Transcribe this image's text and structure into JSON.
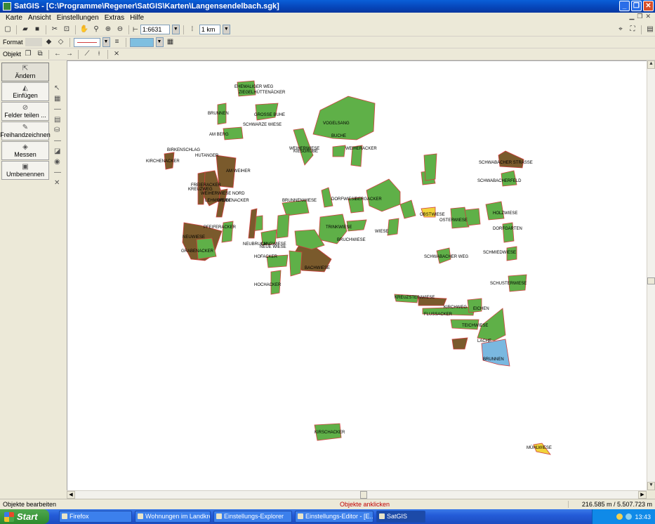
{
  "window": {
    "title": "SatGIS - [C:\\Programme\\Regener\\SatGIS\\Karten\\Langensendelbach.sgk]",
    "buttons": [
      "_",
      "❐",
      "✕"
    ]
  },
  "menu": [
    "Karte",
    "Ansicht",
    "Einstellungen",
    "Extras",
    "Hilfe"
  ],
  "toolbar": {
    "scale_value": "1:6631",
    "distance_value": "1 km",
    "format_label": "Format",
    "objects_label": "Objekt",
    "fill_color": "#7fbfe0"
  },
  "tools": [
    "Ändern",
    "Einfügen",
    "Felder teilen ...",
    "Freihandzeichnen",
    "Messen",
    "Umbenennen"
  ],
  "map": {
    "colors": {
      "green": "#5fb048",
      "brown": "#7a5a2c",
      "yellow": "#f0d43a",
      "blue": "#7ab8e0",
      "outline": "#d04040"
    },
    "labels": [
      "EHEMALIGER WEG",
      "ZIEGELHÜTTENÄCKER",
      "BRUNNEN",
      "GROSSE BUHE",
      "SCHWARZE WIESE",
      "AM BERG",
      "VOGELSANG",
      "BUCHE",
      "WEIHERWIESE",
      "WEIHERACKER",
      "KIESGRUBE",
      "KIRCHENACKER",
      "HUTANGER",
      "AM WEIHER",
      "FREIERACKER",
      "WEIHERWIESE NORD",
      "LEHMGRUBE",
      "BRUNNENWIESE",
      "DORFWIESE",
      "BERGACKER",
      "KREUZWEG",
      "WEIDENACKER",
      "PFEIFERACKER",
      "TRINKWIESE",
      "BRUCHWIESE",
      "NEUWIESE",
      "GRABENACKER",
      "BACHWIESE",
      "NEUBRUCH",
      "NEUE WIESE",
      "WIESE",
      "LANGWIESE",
      "HOFACKER",
      "HOCHACKER",
      "SCHWABACHER STRASSE",
      "SCHWABACHERFELD",
      "HOLZWIESE",
      "OBSTWIESE",
      "OSTERWIESE",
      "DORFGARTEN",
      "SCHMIEDWIESE",
      "SCHUSTERWIESE",
      "SCHWABACHER WEG",
      "KREUZSTEINWIESE",
      "FLUSSACKER",
      "KIRCHWEG",
      "EICHEN",
      "TEICHWIESE",
      "LACHE",
      "BRUNNEN",
      "KIRSCHACKER",
      "MÜHLWIESE",
      "BIRKENSCHLAG"
    ]
  },
  "status": {
    "left": "Objekte bearbeiten",
    "middle": "Objekte anklicken",
    "right": "216.585 m / 5.507.723 m"
  },
  "taskbar": {
    "start": "Start",
    "tasks": [
      "Firefox",
      "Wohnungen im Landkreis",
      "Einstellungs-Explorer",
      "Einstellungs-Editor - [E...",
      "SatGIS"
    ],
    "clock": "13:43"
  }
}
